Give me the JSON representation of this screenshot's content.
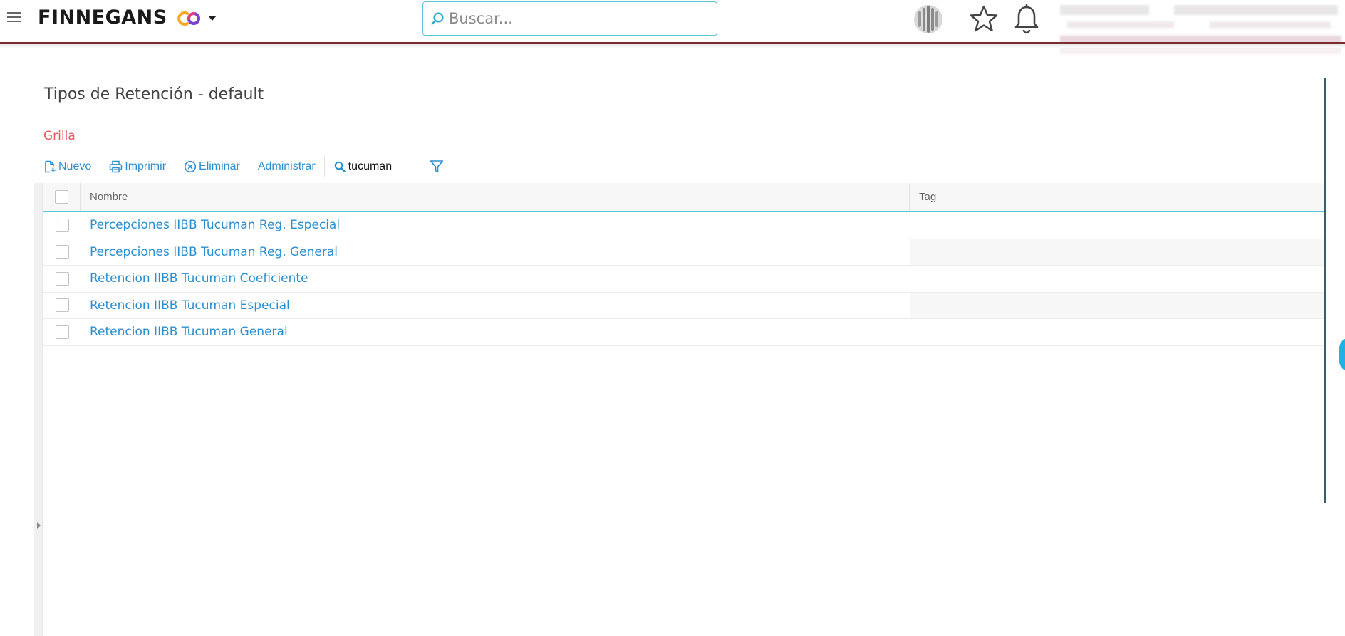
{
  "header": {
    "brand": "FINNEGANS",
    "search_placeholder": "Buscar..."
  },
  "page": {
    "title": "Tipos de Retención - default",
    "view_label": "Grilla"
  },
  "toolbar": {
    "new_label": "Nuevo",
    "print_label": "Imprimir",
    "delete_label": "Eliminar",
    "manage_label": "Administrar",
    "search_value": "tucuman"
  },
  "grid": {
    "columns": [
      "Nombre",
      "Tag"
    ],
    "rows": [
      {
        "nombre": "Percepciones IIBB Tucuman Reg. Especial",
        "tag": ""
      },
      {
        "nombre": "Percepciones IIBB Tucuman Reg. General",
        "tag": ""
      },
      {
        "nombre": "Retencion IIBB Tucuman Coeficiente",
        "tag": ""
      },
      {
        "nombre": "Retencion IIBB Tucuman Especial",
        "tag": ""
      },
      {
        "nombre": "Retencion IIBB Tucuman General",
        "tag": ""
      }
    ]
  },
  "colors": {
    "accent": "#2a8fd0",
    "brand_bar": "#7d2b33",
    "grid_label": "#e8585f",
    "focus_border": "#5cc6d6"
  },
  "icons": [
    "menu-icon",
    "logo-icon",
    "chevron-down-icon",
    "search-icon",
    "assistant-orb-icon",
    "star-icon",
    "bell-icon",
    "new-document-icon",
    "printer-icon",
    "close-circle-icon",
    "filter-icon"
  ]
}
